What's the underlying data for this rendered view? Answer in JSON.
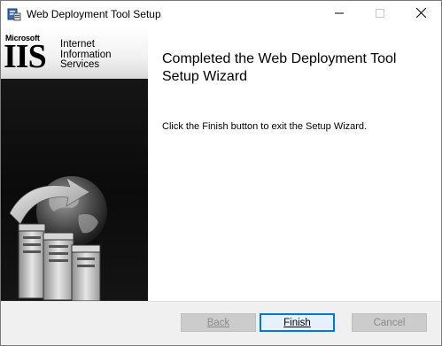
{
  "window": {
    "title": "Web Deployment Tool Setup",
    "icon": "setup-installer-icon"
  },
  "titlebar_controls": {
    "minimize_icon": "minimize-icon",
    "maximize_icon": "maximize-icon",
    "close_icon": "close-icon"
  },
  "banner": {
    "brand_small": "Microsoft",
    "brand_large": "IIS",
    "brand_lines": [
      "Internet",
      "Information",
      "Services"
    ],
    "art": "globe-servers-illustration"
  },
  "content": {
    "heading": "Completed the Web Deployment Tool Setup Wizard",
    "message": "Click the Finish button to exit the Setup Wizard."
  },
  "buttons": {
    "back_label": "Back",
    "finish_label": "Finish",
    "cancel_label": "Cancel"
  },
  "colors": {
    "focus_border": "#0078d7",
    "disabled_text": "#8a8a8a"
  }
}
